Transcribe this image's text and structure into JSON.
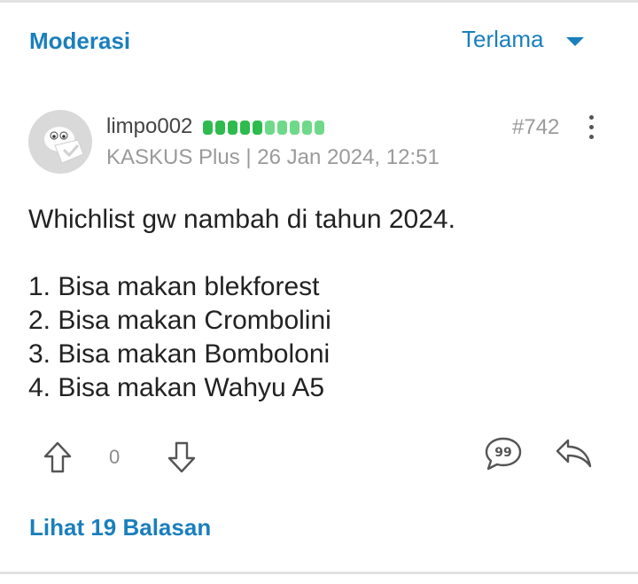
{
  "header": {
    "section_label": "Moderasi",
    "sort": {
      "selected": "Terlama",
      "caret_icon": "chevron-down-icon"
    }
  },
  "post": {
    "avatar": "avatar",
    "username": "limpo002",
    "reputation": {
      "dark_pips": 5,
      "light_pips": 5
    },
    "meta": "KASKUS Plus | 26 Jan 2024, 12:51",
    "post_number": "#742",
    "content": {
      "intro": "Whichlist gw nambah di tahun 2024.",
      "items": [
        "1. Bisa makan blekforest",
        "2. Bisa makan Crombolini",
        "3. Bisa makan Bomboloni",
        "4. Bisa makan Wahyu A5"
      ]
    },
    "actions": {
      "upvote_icon": "arrow-up-icon",
      "vote_count": "0",
      "downvote_icon": "arrow-down-icon",
      "quote_icon": "quote-bubble-icon",
      "reply_icon": "reply-icon"
    },
    "replies_link": "Lihat 19 Balasan"
  },
  "colors": {
    "accent": "#1a7fbd",
    "rep_dark": "#2dbb4e",
    "rep_light": "#6fd98a",
    "muted_text": "#9a9a9a"
  }
}
